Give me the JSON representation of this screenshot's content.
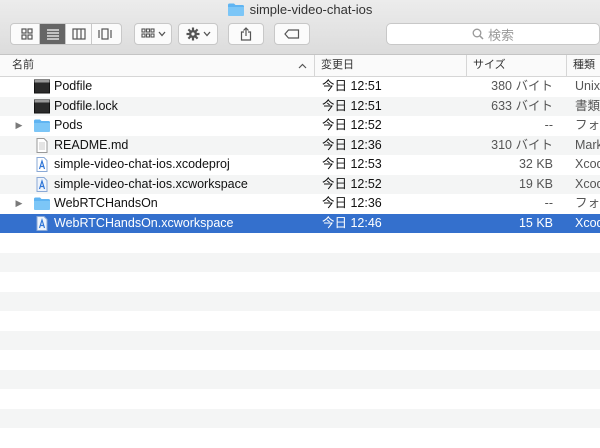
{
  "window": {
    "title": "simple-video-chat-ios"
  },
  "toolbar": {
    "search_placeholder": "検索"
  },
  "columns": {
    "name": "名前",
    "date": "変更日",
    "size": "サイズ",
    "kind": "種類"
  },
  "files": [
    {
      "name": "Podfile",
      "date": "今日 12:51",
      "size": "380 バイト",
      "kind": "Unix",
      "icon": "terminal-file-icon",
      "folder": false
    },
    {
      "name": "Podfile.lock",
      "date": "今日 12:51",
      "size": "633 バイト",
      "kind": "書類",
      "icon": "terminal-file-icon",
      "folder": false
    },
    {
      "name": "Pods",
      "date": "今日 12:52",
      "size": "--",
      "kind": "フォル",
      "icon": "folder-icon",
      "folder": true
    },
    {
      "name": "README.md",
      "date": "今日 12:36",
      "size": "310 バイト",
      "kind": "Mark",
      "icon": "document-icon",
      "folder": false
    },
    {
      "name": "simple-video-chat-ios.xcodeproj",
      "date": "今日 12:53",
      "size": "32 KB",
      "kind": "Xcod",
      "icon": "xcode-project-icon",
      "folder": false
    },
    {
      "name": "simple-video-chat-ios.xcworkspace",
      "date": "今日 12:52",
      "size": "19 KB",
      "kind": "Xcod",
      "icon": "xcode-workspace-icon",
      "folder": false
    },
    {
      "name": "WebRTCHandsOn",
      "date": "今日 12:36",
      "size": "--",
      "kind": "フォル",
      "icon": "folder-icon",
      "folder": true
    },
    {
      "name": "WebRTCHandsOn.xcworkspace",
      "date": "今日 12:46",
      "size": "15 KB",
      "kind": "Xcod",
      "icon": "xcode-workspace-icon",
      "folder": false,
      "selected": true
    }
  ],
  "colors": {
    "selection": "#3470cd",
    "folder": "#5fb4f2"
  }
}
